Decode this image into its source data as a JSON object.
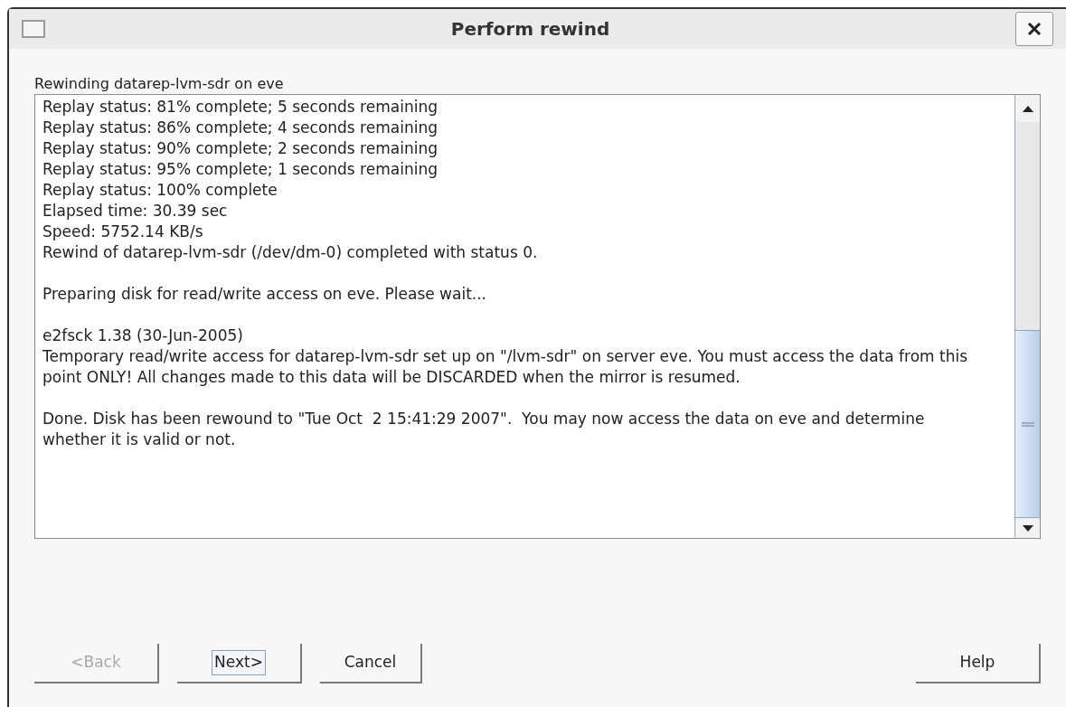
{
  "window": {
    "title": "Perform rewind"
  },
  "caption": "Rewinding datarep-lvm-sdr on eve",
  "log_blocks": [
    [
      "Replay status: 81% complete; 5 seconds remaining",
      "Replay status: 86% complete; 4 seconds remaining",
      "Replay status: 90% complete; 2 seconds remaining",
      "Replay status: 95% complete; 1 seconds remaining",
      "Replay status: 100% complete",
      "Elapsed time: 30.39 sec",
      "Speed: 5752.14 KB/s",
      "Rewind of datarep-lvm-sdr (/dev/dm-0) completed with status 0."
    ],
    [
      "Preparing disk for read/write access on eve. Please wait..."
    ],
    [
      "e2fsck 1.38 (30-Jun-2005)",
      "Temporary read/write access for datarep-lvm-sdr set up on \"/lvm-sdr\" on server eve. You must access the data from this point ONLY! All changes made to this data will be DISCARDED when the mirror is resumed."
    ],
    [
      "Done. Disk has been rewound to \"Tue Oct  2 15:41:29 2007\".  You may now access the data on eve and determine whether it is valid or not."
    ]
  ],
  "buttons": [
    {
      "label": "<Back",
      "disabled": true,
      "focused": false
    },
    {
      "label": "Next>",
      "disabled": false,
      "focused": true
    },
    {
      "label": "Cancel",
      "disabled": false,
      "focused": false
    }
  ],
  "help_button": {
    "label": "Help",
    "disabled": false
  }
}
